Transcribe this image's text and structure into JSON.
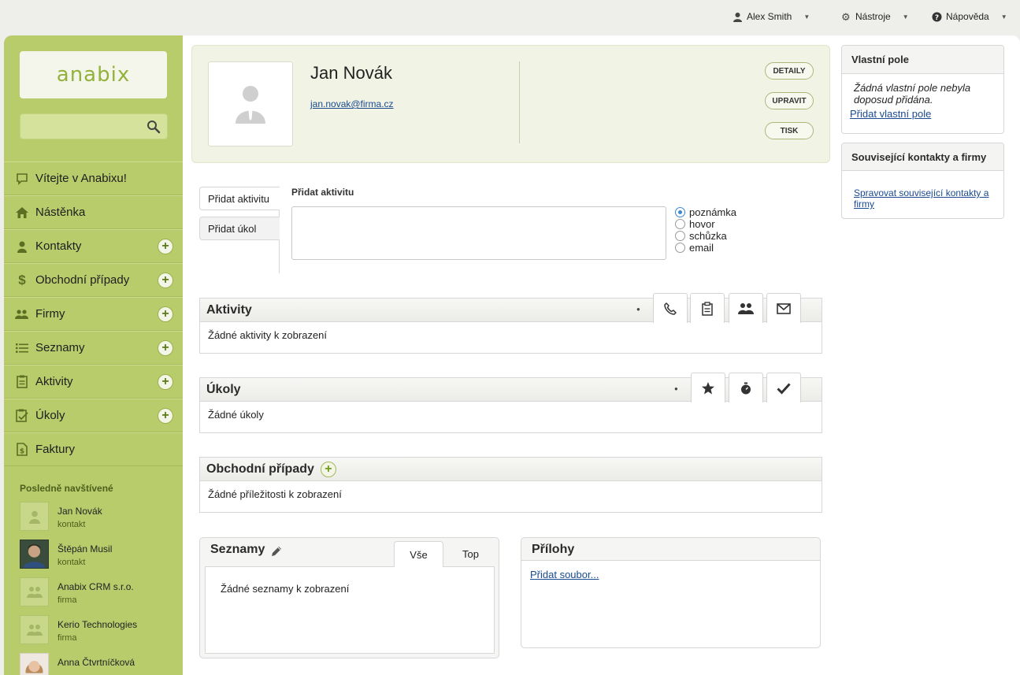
{
  "topbar": {
    "user": "Alex Smith",
    "tools": "Nástroje",
    "help": "Nápověda"
  },
  "sidebar": {
    "logo": "anabix",
    "search_placeholder": "",
    "items": [
      {
        "label": "Vítejte v Anabixu!",
        "icon": "speech-bubble-icon",
        "plus": false
      },
      {
        "label": "Nástěnka",
        "icon": "home-icon",
        "plus": false
      },
      {
        "label": "Kontakty",
        "icon": "person-icon",
        "plus": true
      },
      {
        "label": "Obchodní případy",
        "icon": "dollar-icon",
        "plus": true
      },
      {
        "label": "Firmy",
        "icon": "group-icon",
        "plus": true
      },
      {
        "label": "Seznamy",
        "icon": "list-icon",
        "plus": true
      },
      {
        "label": "Aktivity",
        "icon": "clipboard-icon",
        "plus": true
      },
      {
        "label": "Úkoly",
        "icon": "task-icon",
        "plus": true
      },
      {
        "label": "Faktury",
        "icon": "invoice-icon",
        "plus": false
      }
    ],
    "recent_title": "Posledně navštívené",
    "recent": [
      {
        "name": "Jan Novák",
        "type": "kontakt"
      },
      {
        "name": "Štěpán Musil",
        "type": "kontakt"
      },
      {
        "name": "Anabix CRM s.r.o.",
        "type": "firma"
      },
      {
        "name": "Kerio Technologies",
        "type": "firma"
      },
      {
        "name": "Anna Čtvrtníčková",
        "type": ""
      }
    ]
  },
  "contact": {
    "name": "Jan Novák",
    "email": "jan.novak@firma.cz",
    "buttons": {
      "details": "DETAILY",
      "edit": "UPRAVIT",
      "print": "TISK"
    }
  },
  "add_activity": {
    "tabs": [
      "Přidat aktivitu",
      "Přidat úkol"
    ],
    "heading": "Přidat aktivitu",
    "types": [
      "poznámka",
      "hovor",
      "schůzka",
      "email"
    ],
    "selected": "poznámka"
  },
  "activities": {
    "title": "Aktivity",
    "empty": "Žádné aktivity k zobrazení"
  },
  "tasks": {
    "title": "Úkoly",
    "empty": "Žádné úkoly"
  },
  "deals": {
    "title": "Obchodní případy",
    "empty": "Žádné příležitosti k zobrazení"
  },
  "lists": {
    "title": "Seznamy",
    "tabs": [
      "Vše",
      "Top"
    ],
    "empty": "Žádné seznamy k zobrazení"
  },
  "attachments": {
    "title": "Přílohy",
    "add": "Přidat soubor..."
  },
  "custom_fields": {
    "title": "Vlastní pole",
    "empty": "Žádná vlastní pole nebyla doposud přidána.",
    "add": "Přidat vlastní pole"
  },
  "related": {
    "title": "Související kontakty a firmy",
    "link": "Spravovat související kontakty a firmy"
  },
  "colors": {
    "sidebar": "#b9cc6c",
    "accent": "#93b23b",
    "link": "#1a4a8f"
  }
}
